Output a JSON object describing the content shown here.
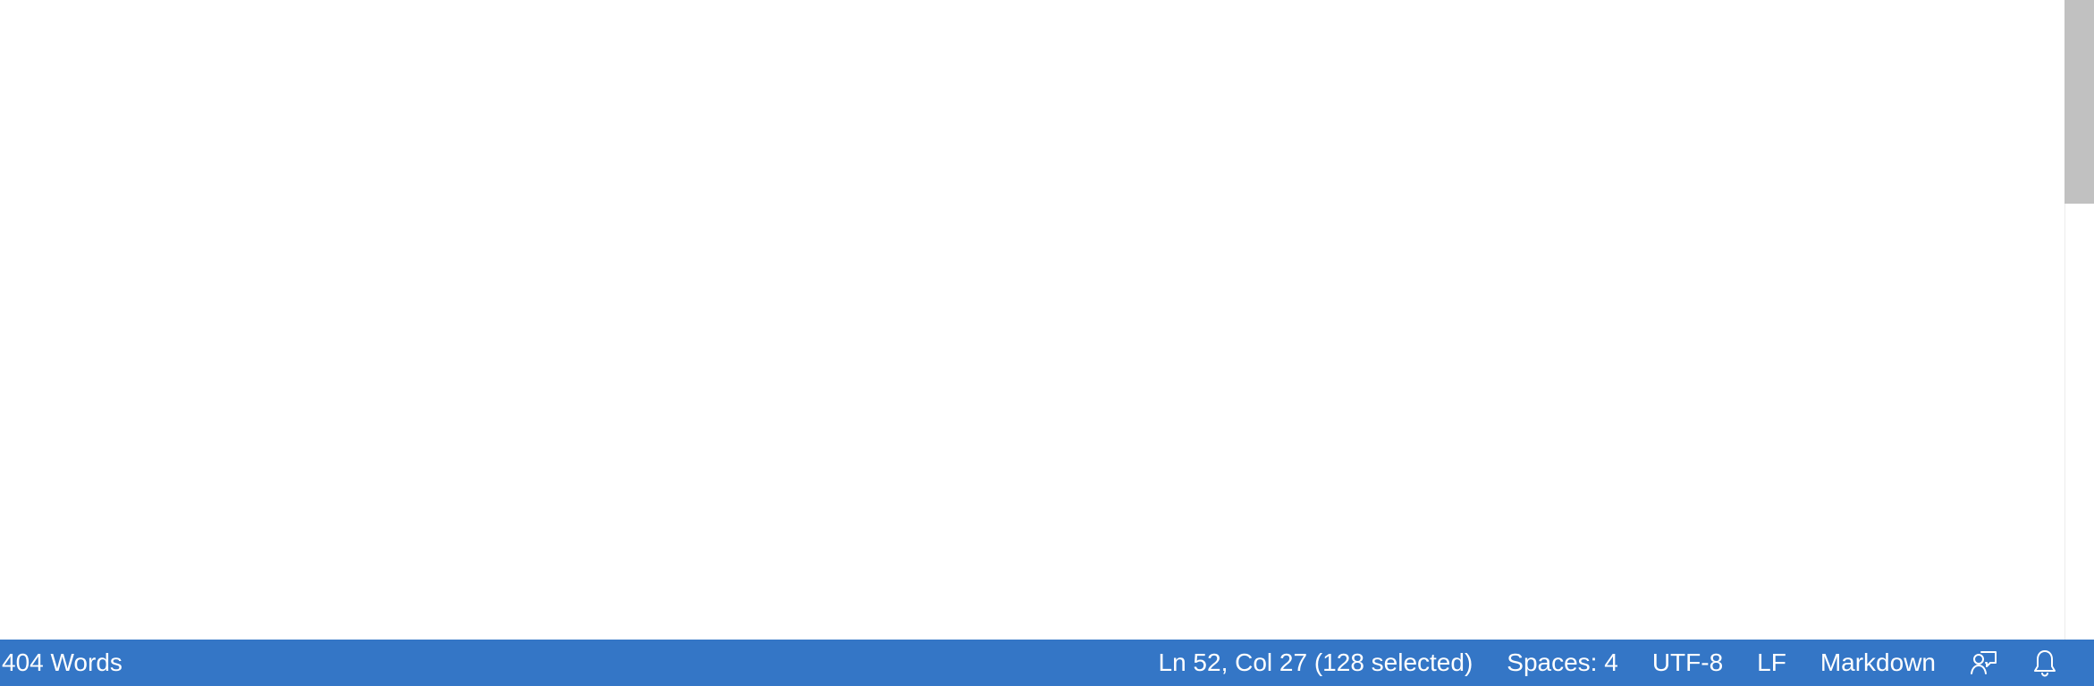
{
  "colors": {
    "status_bar_bg": "#3476c6",
    "status_bar_fg": "#ffffff",
    "editor_bg": "#ffffff",
    "scrollbar_thumb": "#c1c1c1"
  },
  "status_bar": {
    "word_count": "404 Words",
    "cursor_position": "Ln 52, Col 27 (128 selected)",
    "indentation": "Spaces: 4",
    "encoding": "UTF-8",
    "end_of_line": "LF",
    "language_mode": "Markdown",
    "icons": [
      "feedback-icon",
      "bell-icon"
    ]
  }
}
